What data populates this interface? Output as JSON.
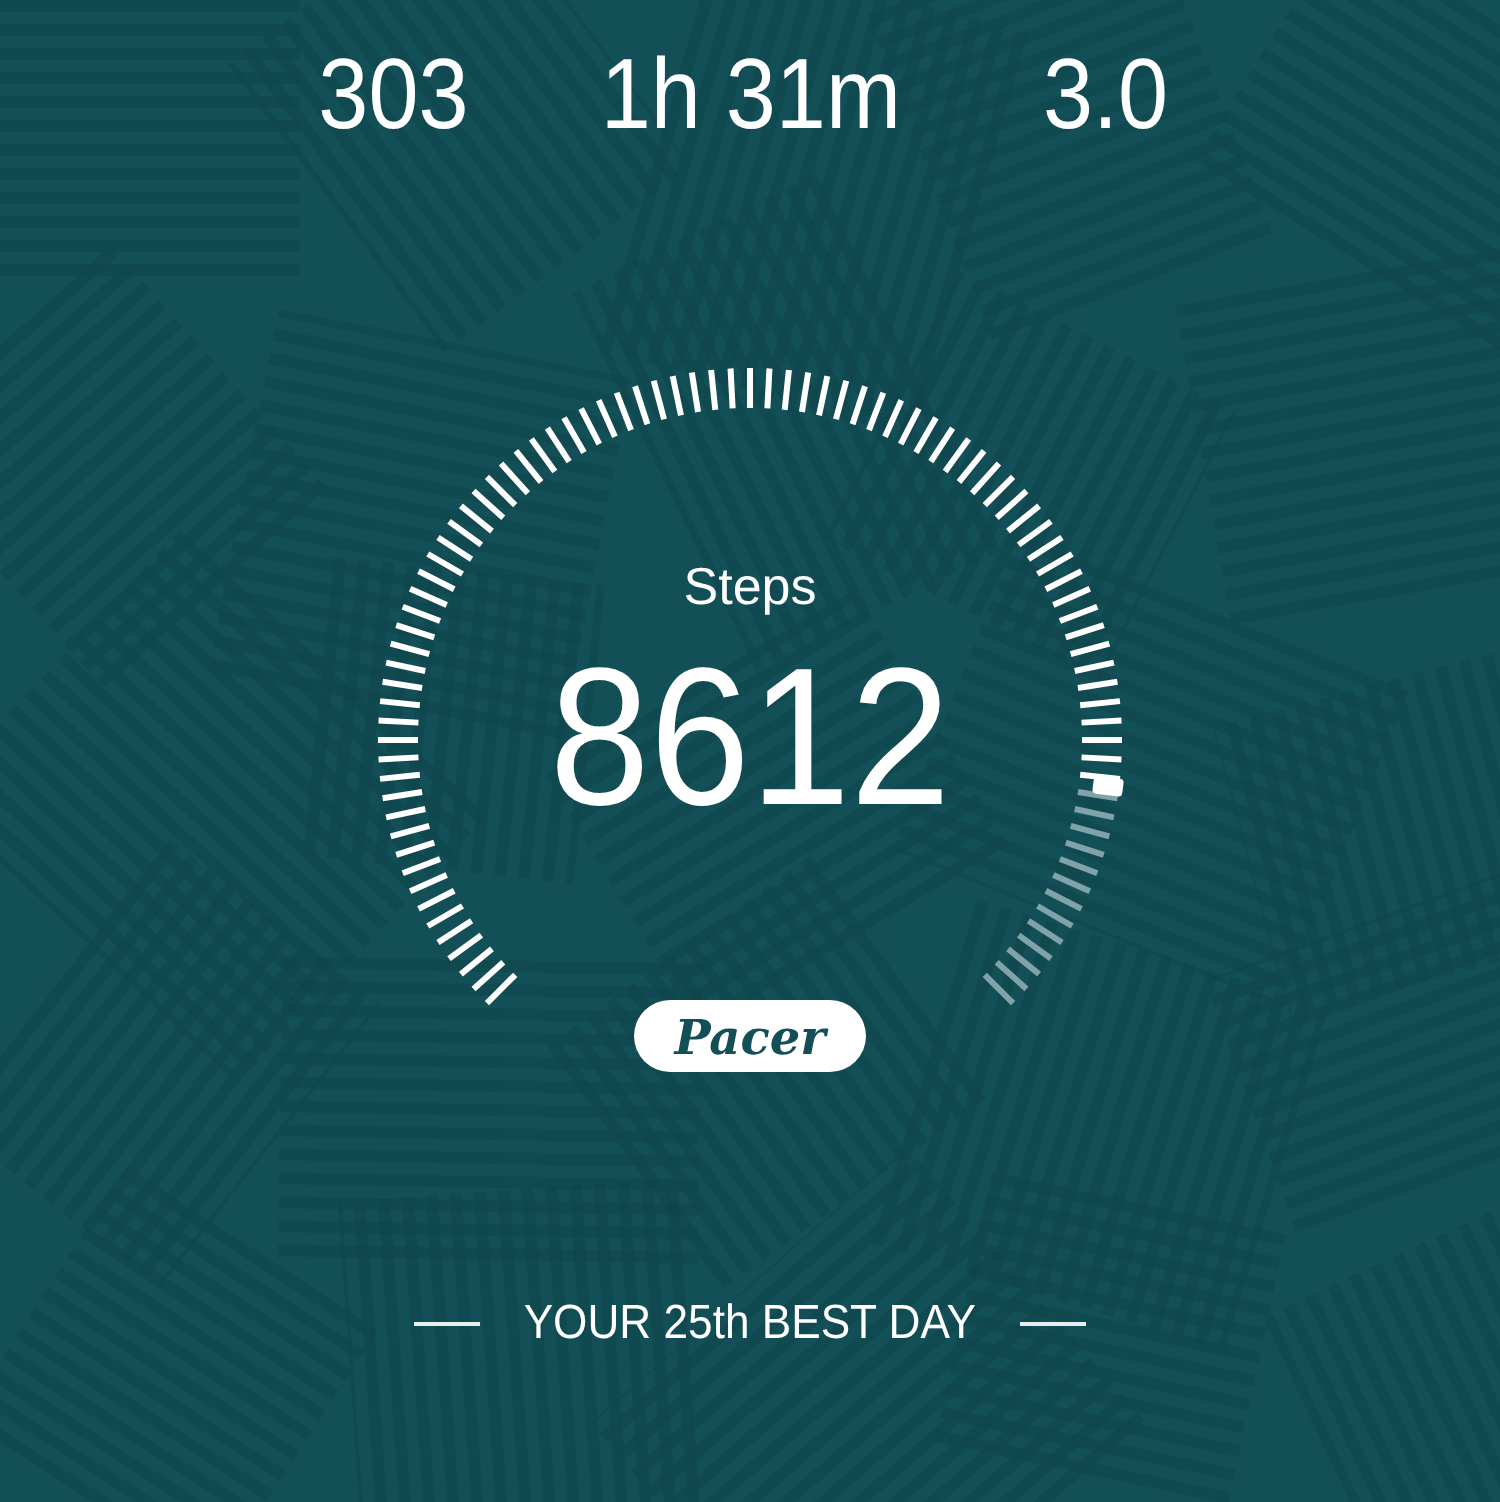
{
  "stats": [
    {
      "value": "303"
    },
    {
      "value": "1h 31m"
    },
    {
      "value": "3.0"
    }
  ],
  "gauge": {
    "label": "Steps",
    "value": "8612"
  },
  "logo": {
    "text": "Pacer"
  },
  "rank": "YOUR 25th BEST DAY"
}
